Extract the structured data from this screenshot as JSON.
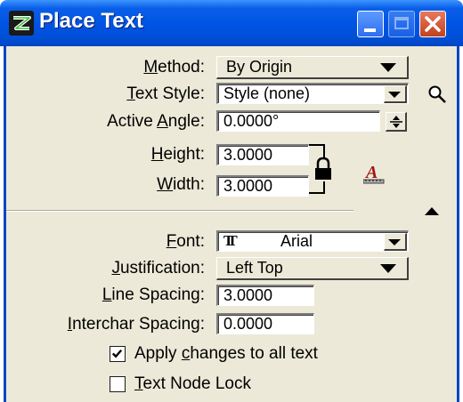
{
  "window": {
    "title": "Place Text"
  },
  "form": {
    "method": {
      "label_pre": "",
      "label_key": "M",
      "label_post": "ethod:",
      "value": "By Origin"
    },
    "text_style": {
      "label_pre": "",
      "label_key": "T",
      "label_post": "ext Style:",
      "value": "Style (none)"
    },
    "active_angle": {
      "label_pre": "Active ",
      "label_key": "A",
      "label_post": "ngle:",
      "value": "0.0000°"
    },
    "height": {
      "label_pre": "",
      "label_key": "H",
      "label_post": "eight:",
      "value": "3.0000"
    },
    "width": {
      "label_pre": "",
      "label_key": "W",
      "label_post": "idth:",
      "value": "3.0000"
    },
    "font": {
      "label_pre": "",
      "label_key": "F",
      "label_post": "ont:",
      "value": "Arial",
      "glyph": "TT"
    },
    "justification": {
      "label_pre": "",
      "label_key": "J",
      "label_post": "ustification:",
      "value": "Left Top"
    },
    "line_spacing": {
      "label_pre": "",
      "label_key": "L",
      "label_post": "ine Spacing:",
      "value": "3.0000"
    },
    "interchar_spacing": {
      "label_pre": "",
      "label_key": "I",
      "label_post": "nterchar Spacing:",
      "value": "0.0000"
    },
    "apply_all": {
      "label_pre": "Apply ",
      "label_key": "c",
      "label_post": "hanges to all text",
      "checked": true
    },
    "node_lock": {
      "label_pre": "",
      "label_key": "T",
      "label_post": "ext Node Lock",
      "checked": false
    }
  },
  "colors": {
    "title_bar": "#0054e3",
    "panel": "#ece9d8",
    "close": "#c2411d",
    "match_icon": "#a31515"
  },
  "icons": [
    "app-icon",
    "minimize-icon",
    "maximize-icon",
    "close-icon",
    "magnifier-icon",
    "spin-icon",
    "lock-icon",
    "match-text-icon",
    "collapse-icon",
    "truetype-icon"
  ]
}
